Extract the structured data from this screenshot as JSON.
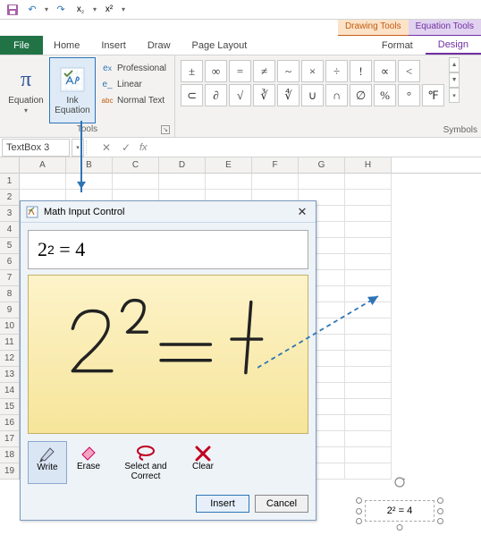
{
  "qat": {
    "save": "💾",
    "undo": "↶",
    "redo": "↷"
  },
  "tabs": {
    "file": "File",
    "home": "Home",
    "insert": "Insert",
    "draw": "Draw",
    "page_layout": "Page Layout"
  },
  "context": {
    "drawing": "Drawing Tools",
    "equation": "Equation Tools",
    "format": "Format",
    "design": "Design"
  },
  "ribbon": {
    "equation_label": "Equation",
    "ink_label": "Ink Equation",
    "professional": "Professional",
    "linear": "Linear",
    "normal": "Normal Text",
    "group_tools": "Tools",
    "group_symbols": "Symbols",
    "sym_row1": [
      "±",
      "∞",
      "=",
      "≠",
      "~",
      "×",
      "÷",
      "!",
      "∝",
      "<"
    ],
    "sym_row2": [
      "⊂",
      "∂",
      "√",
      "∛",
      "∜",
      "∪",
      "∩",
      "∅",
      "%",
      "°",
      "℉"
    ]
  },
  "namebox": "TextBox 3",
  "cols": [
    "A",
    "B",
    "C",
    "D",
    "E",
    "F",
    "G",
    "H"
  ],
  "rows": [
    "1",
    "2",
    "3",
    "4",
    "5",
    "6",
    "7",
    "8",
    "9",
    "10",
    "11",
    "12",
    "13",
    "14",
    "15",
    "16",
    "17",
    "18",
    "19"
  ],
  "sheet_formula": "2² = 4",
  "dialog": {
    "title": "Math Input Control",
    "preview": "2² = 4",
    "tools": {
      "write": "Write",
      "erase": "Erase",
      "select": "Select and Correct",
      "clear": "Clear"
    },
    "insert": "Insert",
    "cancel": "Cancel"
  }
}
